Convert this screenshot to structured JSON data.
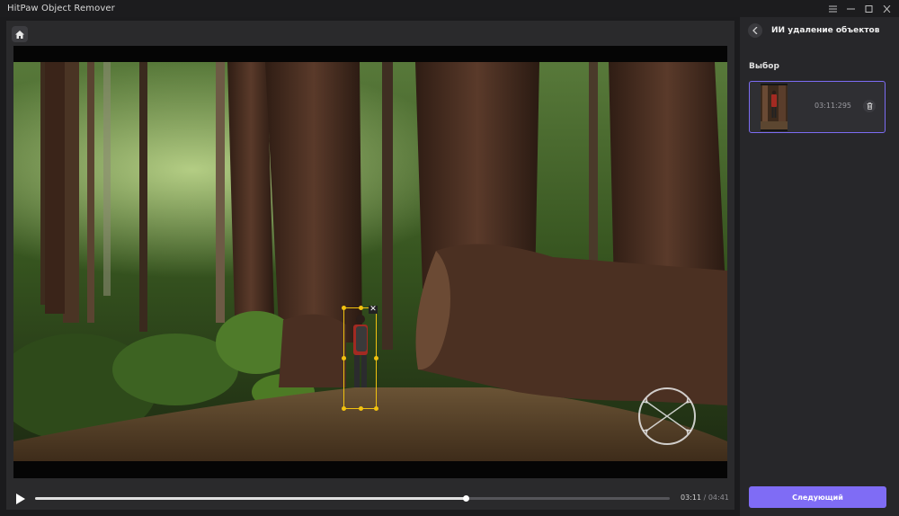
{
  "window": {
    "title": "HitPaw Object Remover",
    "controls": [
      "menu-icon",
      "minimize-icon",
      "maximize-icon",
      "close-icon"
    ]
  },
  "player": {
    "current_time": "03:11",
    "separator": " / ",
    "total_time": "04:41",
    "progress": 0.679
  },
  "sidebar": {
    "title": "ИИ удаление объектов",
    "section_label": "Выбор",
    "clips": [
      {
        "time": "03:11:295"
      }
    ],
    "next_label": "Следующий"
  },
  "colors": {
    "accent": "#7f6cf5",
    "selection": "#f2c20f"
  }
}
